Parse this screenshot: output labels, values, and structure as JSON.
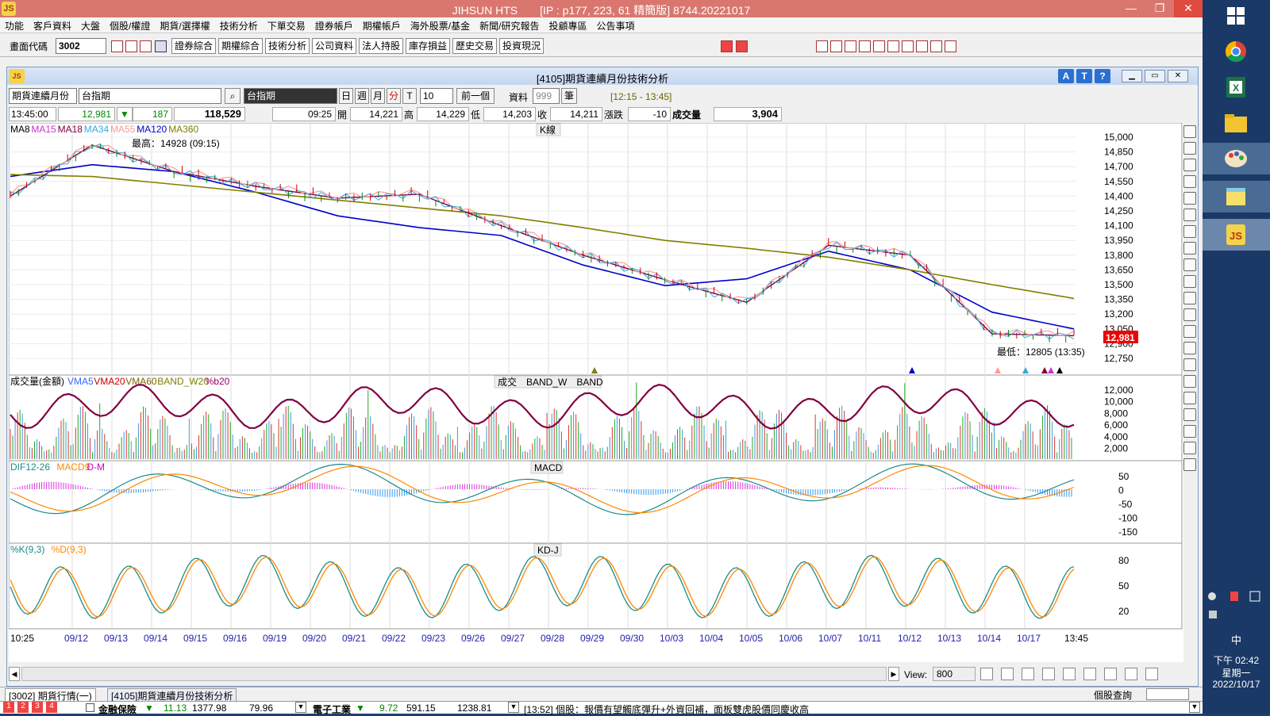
{
  "window": {
    "title": "JIHSUN HTS　　[IP : p177, 223, 61 精簡版] 8744.20221017",
    "logo_icon": "jihsun-logo-icon",
    "min": "—",
    "max": "❐",
    "close": "✕"
  },
  "menu": [
    "功能",
    "客戶資料",
    "大盤",
    "個股/權證",
    "期貨/選擇權",
    "技術分析",
    "下單交易",
    "證券帳戶",
    "期權帳戶",
    "海外股票/基金",
    "新聞/研究報告",
    "投顧專區",
    "公告事項"
  ],
  "toolbar": {
    "code_label": "畫面代碼",
    "code_value": "3002",
    "buttons": [
      "證券綜合",
      "期權綜合",
      "技術分析",
      "公司資料",
      "法人持股",
      "庫存損益",
      "歷史交易",
      "投資現況"
    ]
  },
  "inner": {
    "title": "[4105]期貨連續月份技術分析",
    "btn_a": "A",
    "btn_t": "T",
    "btn_q": "?"
  },
  "controls": {
    "contract_type": "期貨連續月份",
    "symbol": "台指期",
    "symbol_name": "台指期",
    "period_day": "日",
    "period_week": "週",
    "period_month": "月",
    "period_min": "分",
    "period_tick": "T",
    "interval": "10",
    "prev": "前一個",
    "data_label": "資料",
    "data_count": "999",
    "unit": "筆",
    "range": "[12:15 - 13:45]"
  },
  "quote": {
    "time": "13:45:00",
    "price": "12,981",
    "change_arrow": "▼",
    "change": "187",
    "volume": "118,529",
    "bar_time": "09:25",
    "open_label": "開",
    "open": "14,221",
    "high_label": "高",
    "high": "14,229",
    "low_label": "低",
    "low": "14,203",
    "close_label": "收",
    "close": "14,211",
    "diff_label": "漲跌",
    "diff": "-10",
    "vol_label": "成交量",
    "vol": "3,904"
  },
  "panels": {
    "kline": {
      "title": "K線",
      "ma_labels": [
        {
          "t": "MA8",
          "c": "#000000"
        },
        {
          "t": "MA15",
          "c": "#cc33cc"
        },
        {
          "t": "MA18",
          "c": "#800040"
        },
        {
          "t": "MA34",
          "c": "#33aadd"
        },
        {
          "t": "MA55",
          "c": "#ff9999"
        },
        {
          "t": "MA120",
          "c": "#0000cc"
        },
        {
          "t": "MA360",
          "c": "#808000"
        }
      ],
      "high_note": "最高：14928 (09:15)",
      "low_note": "最低：12805 (13:35)",
      "last_price": "12,981",
      "yticks": [
        "15,000",
        "14,850",
        "14,700",
        "14,550",
        "14,400",
        "14,250",
        "14,100",
        "13,950",
        "13,800",
        "13,650",
        "13,500",
        "13,350",
        "13,200",
        "13,050",
        "12,900",
        "12,750"
      ]
    },
    "volume": {
      "title": "成交量(金額)",
      "center": "成交　BAND_W　BAND",
      "labels": [
        {
          "t": "VMA5",
          "c": "#3366ff"
        },
        {
          "t": "VMA20",
          "c": "#cc0000"
        },
        {
          "t": "VMA60",
          "c": "#806000"
        },
        {
          "t": "BAND_W20",
          "c": "#808000"
        },
        {
          "t": "%b20",
          "c": "#990066"
        }
      ],
      "yticks": [
        "12,000",
        "10,000",
        "8,000",
        "6,000",
        "4,000",
        "2,000"
      ]
    },
    "macd": {
      "title": "MACD",
      "labels": [
        {
          "t": "DIF12-26",
          "c": "#1b8a8a"
        },
        {
          "t": "MACD9",
          "c": "#ff8800"
        },
        {
          "t": "D-M",
          "c": "#cc00cc"
        }
      ],
      "yticks": [
        "50",
        "0",
        "-50",
        "-100",
        "-150"
      ]
    },
    "kd": {
      "title": "KD-J",
      "labels": [
        {
          "t": "%K(9,3)",
          "c": "#1b8a8a"
        },
        {
          "t": "%D(9,3)",
          "c": "#ff8800"
        }
      ],
      "yticks": [
        "80",
        "50",
        "20"
      ]
    }
  },
  "xaxis": [
    "10:25",
    "09/12",
    "09/13",
    "09/14",
    "09/15",
    "09/16",
    "09/19",
    "09/20",
    "09/21",
    "09/22",
    "09/23",
    "09/26",
    "09/27",
    "09/28",
    "09/29",
    "09/30",
    "10/03",
    "10/04",
    "10/05",
    "10/06",
    "10/07",
    "10/11",
    "10/12",
    "10/13",
    "10/14",
    "10/17",
    "13:45"
  ],
  "statusbar": {
    "view_label": "View:",
    "view_value": "800"
  },
  "tabs": [
    "[3002]  期貨行情(一)",
    "[4105]期貨連續月份技術分析"
  ],
  "query": "個股查詢",
  "ticker": {
    "item1_name": "金融保險",
    "item1_arrow": "▼",
    "item1_chg": "11.13",
    "item1_val": "1377.98",
    "item1_v2": "79.96",
    "item2_name": "電子工業",
    "item2_arrow": "▼",
    "item2_chg": "9.72",
    "item2_val": "591.15",
    "item2_v2": "1238.81",
    "news": "[13:52]  個股：報價有望觸底彈升+外資回補，面板雙虎股價同慶收高"
  },
  "tray": {
    "input_method": "中",
    "time": "下午 02:42",
    "weekday": "星期一",
    "date": "2022/10/17"
  },
  "chart_data": [
    {
      "type": "line",
      "title": "K線",
      "series": [
        {
          "name": "MA120",
          "values": [
            14600,
            14720,
            14650,
            14440,
            14200,
            14080,
            14000,
            13700,
            13490,
            13560,
            13840,
            13650,
            13220,
            13050
          ]
        },
        {
          "name": "MA360",
          "values": [
            14620,
            14600,
            14520,
            14440,
            14360,
            14280,
            14200,
            14080,
            13950,
            13870,
            13780,
            13650,
            13500,
            13360
          ]
        },
        {
          "name": "Close",
          "values": [
            14400,
            14920,
            14650,
            14500,
            14380,
            14420,
            14100,
            13800,
            13550,
            13320,
            13900,
            13800,
            13000,
            12981
          ]
        }
      ],
      "ylim": [
        12700,
        15050
      ]
    },
    {
      "type": "bar",
      "title": "成交量(金額)",
      "ylim": [
        0,
        12000
      ]
    },
    {
      "type": "line",
      "title": "MACD",
      "ylim": [
        -170,
        70
      ]
    },
    {
      "type": "line",
      "title": "KD-J",
      "ylim": [
        0,
        100
      ]
    }
  ]
}
